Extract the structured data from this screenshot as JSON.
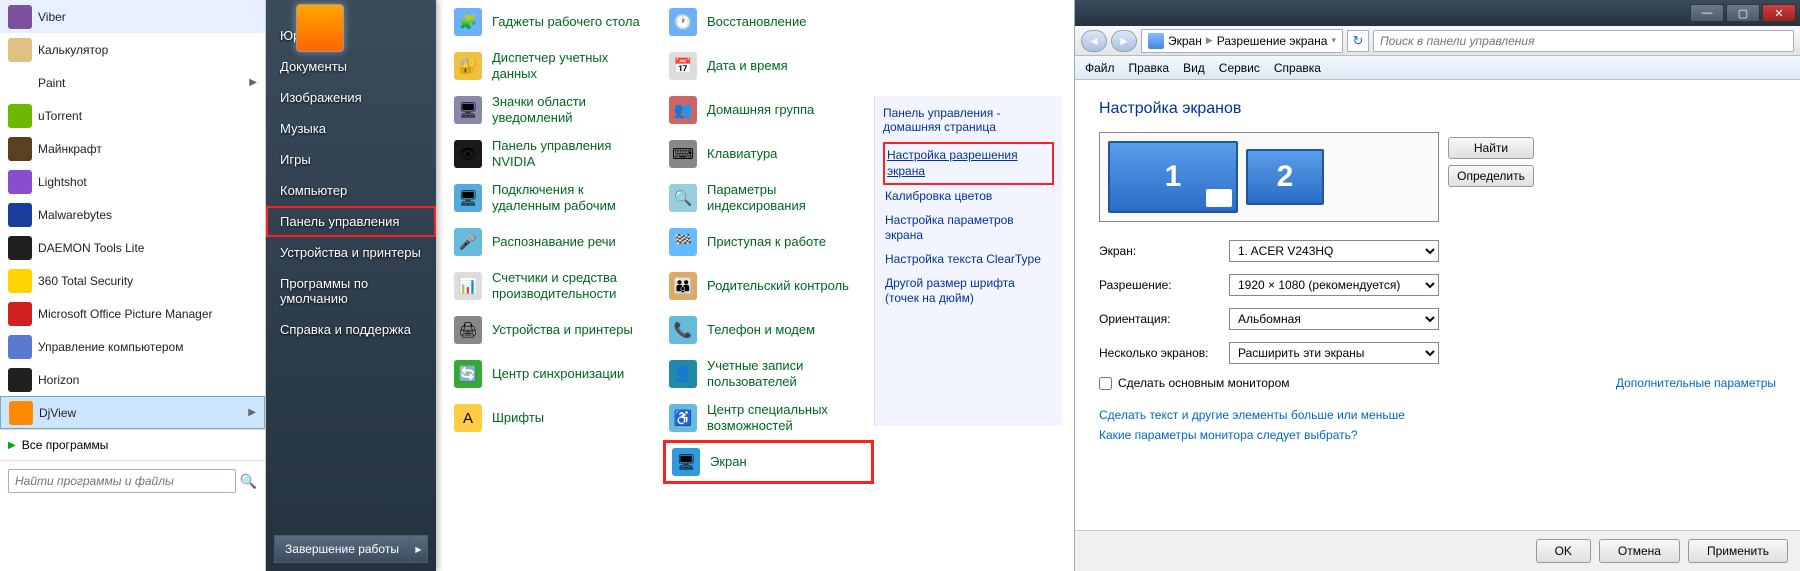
{
  "startmenu": {
    "left_items": [
      {
        "label": "Viber",
        "icon_bg": "#7b519d"
      },
      {
        "label": "Калькулятор",
        "icon_bg": "#e0c080"
      },
      {
        "label": "Paint",
        "icon_bg": "#ffffff",
        "arrow": true
      },
      {
        "label": "uTorrent",
        "icon_bg": "#6fb800"
      },
      {
        "label": "Майнкрафт",
        "icon_bg": "#5a4020"
      },
      {
        "label": "Lightshot",
        "icon_bg": "#8a4dd0"
      },
      {
        "label": "Malwarebytes",
        "icon_bg": "#1a3d9a"
      },
      {
        "label": "DAEMON Tools Lite",
        "icon_bg": "#202020"
      },
      {
        "label": "360 Total Security",
        "icon_bg": "#ffd400"
      },
      {
        "label": "Microsoft Office Picture Manager",
        "icon_bg": "#d02020"
      },
      {
        "label": "Управление компьютером",
        "icon_bg": "#5a7ad0"
      },
      {
        "label": "Horizon",
        "icon_bg": "#202020"
      },
      {
        "label": "DjView",
        "icon_bg": "#ff8a00",
        "selected": true,
        "arrow": true
      }
    ],
    "all_programs": "Все программы",
    "search_placeholder": "Найти программы и файлы",
    "right_items": [
      "Юрец",
      "Документы",
      "Изображения",
      "Музыка",
      "Игры",
      "Компьютер",
      "Панель управления",
      "Устройства и принтеры",
      "Программы по умолчанию",
      "Справка и поддержка"
    ],
    "right_highlight_index": 6,
    "shutdown": "Завершение работы"
  },
  "control_panel": {
    "items_left": [
      {
        "label": "Гаджеты рабочего стола",
        "icon": "🧩",
        "bg": "#6ab0ff"
      },
      {
        "label": "Диспетчер учетных данных",
        "icon": "🔐",
        "bg": "#f0c040"
      },
      {
        "label": "Значки области уведомлений",
        "icon": "🖥",
        "bg": "#88a"
      },
      {
        "label": "Панель управления NVIDIA",
        "icon": "👁",
        "bg": "#1a1a1a"
      },
      {
        "label": "Подключения к удаленным рабочим",
        "icon": "🖥",
        "bg": "#5ad"
      },
      {
        "label": "Распознавание речи",
        "icon": "🎤",
        "bg": "#6bd"
      },
      {
        "label": "Счетчики и средства производительности",
        "icon": "📊",
        "bg": "#ddd"
      },
      {
        "label": "Устройства и принтеры",
        "icon": "🖨",
        "bg": "#888"
      },
      {
        "label": "Центр синхронизации",
        "icon": "🔄",
        "bg": "#3a3"
      },
      {
        "label": "Шрифты",
        "icon": "A",
        "bg": "#fc4"
      }
    ],
    "items_right": [
      {
        "label": "Восстановление",
        "icon": "🕐",
        "bg": "#6ab0ff"
      },
      {
        "label": "Дата и время",
        "icon": "📅",
        "bg": "#ddd"
      },
      {
        "label": "Домашняя группа",
        "icon": "👥",
        "bg": "#c66"
      },
      {
        "label": "Клавиатура",
        "icon": "⌨",
        "bg": "#888"
      },
      {
        "label": "Параметры индексирования",
        "icon": "🔍",
        "bg": "#9cd"
      },
      {
        "label": "Приступая к работе",
        "icon": "🏁",
        "bg": "#6bf"
      },
      {
        "label": "Родительский контроль",
        "icon": "👪",
        "bg": "#da6"
      },
      {
        "label": "Телефон и модем",
        "icon": "📞",
        "bg": "#6bd"
      },
      {
        "label": "Учетные записи пользователей",
        "icon": "👤",
        "bg": "#28a"
      },
      {
        "label": "Центр специальных возможностей",
        "icon": "♿",
        "bg": "#6bd"
      },
      {
        "label": "Экран",
        "icon": "🖥",
        "bg": "#39d",
        "redbox": true
      }
    ],
    "side": {
      "head": "Панель управления - домашняя страница",
      "links": [
        {
          "label": "Настройка разрешения экрана",
          "redbox": true
        },
        {
          "label": "Калибровка цветов"
        },
        {
          "label": "Настройка параметров экрана"
        },
        {
          "label": "Настройка текста ClearType"
        },
        {
          "label": "Другой размер шрифта (точек на дюйм)"
        }
      ]
    }
  },
  "reswin": {
    "breadcrumb": {
      "seg1": "Экран",
      "seg2": "Разрешение экрана"
    },
    "search_placeholder": "Поиск в панели управления",
    "menu": [
      "Файл",
      "Правка",
      "Вид",
      "Сервис",
      "Справка"
    ],
    "title": "Настройка экранов",
    "monitor_buttons": {
      "find": "Найти",
      "detect": "Определить"
    },
    "form": {
      "screen_label": "Экран:",
      "screen_value": "1. ACER V243HQ",
      "res_label": "Разрешение:",
      "res_value": "1920 × 1080 (рекомендуется)",
      "orient_label": "Ориентация:",
      "orient_value": "Альбомная",
      "multi_label": "Несколько экранов:",
      "multi_value": "Расширить эти экраны",
      "primary_check": "Сделать основным монитором",
      "extra_link": "Дополнительные параметры"
    },
    "links": [
      "Сделать текст и другие элементы больше или меньше",
      "Какие параметры монитора следует выбрать?"
    ],
    "buttons": {
      "ok": "OK",
      "cancel": "Отмена",
      "apply": "Применить"
    }
  }
}
